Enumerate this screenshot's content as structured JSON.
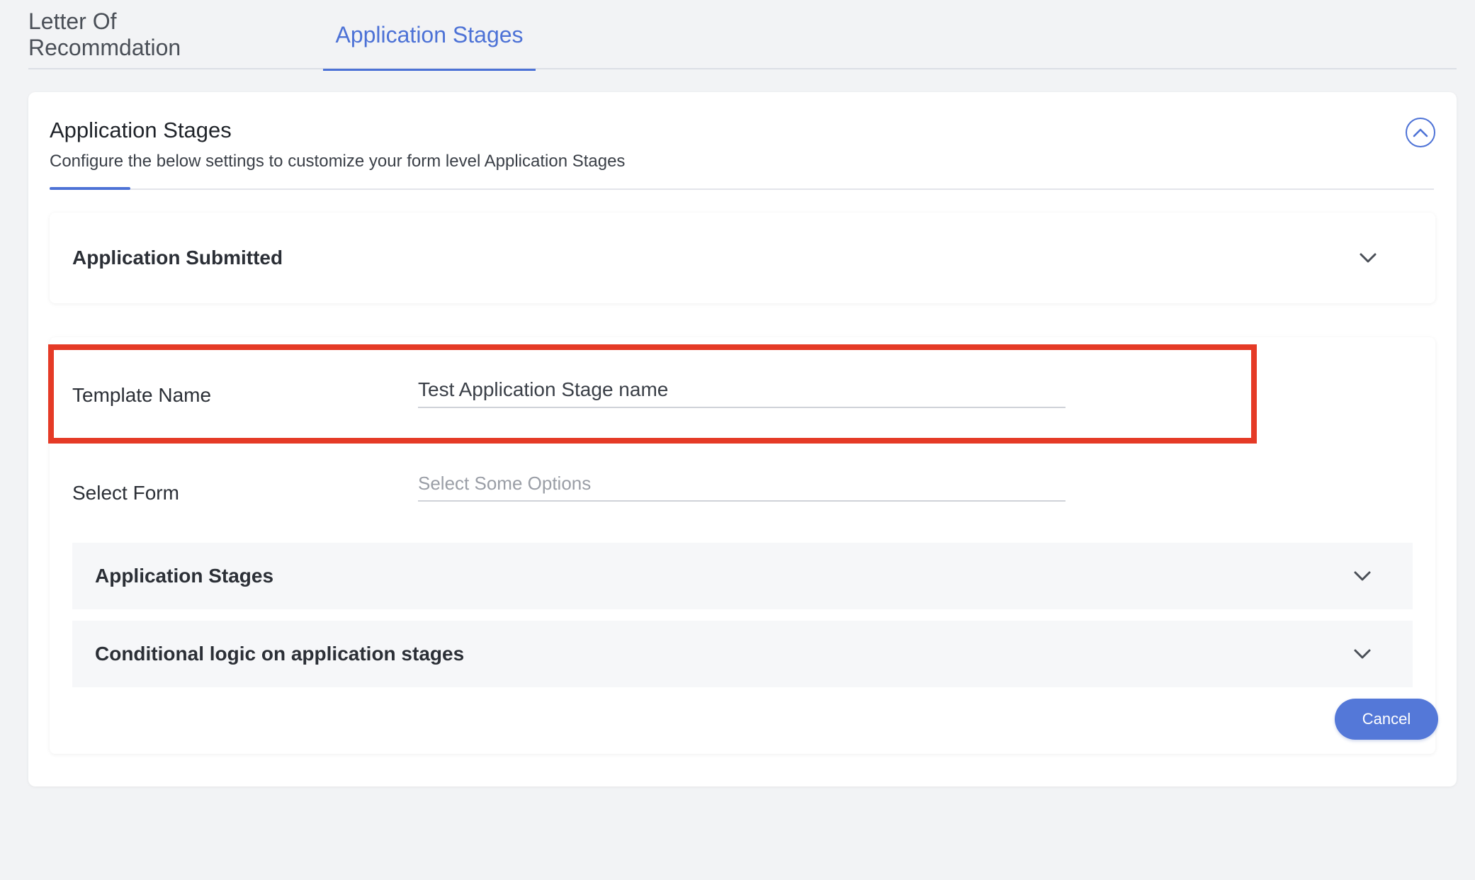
{
  "tabs": [
    {
      "label": "Letter Of Recommdation",
      "active": false
    },
    {
      "label": "Application Stages",
      "active": true
    }
  ],
  "card": {
    "title": "Application Stages",
    "subtitle": "Configure the below settings to customize your form level Application Stages",
    "collapse_icon": "chevron-up-circle-icon"
  },
  "accordions": {
    "application_submitted": {
      "label": "Application Submitted",
      "icon": "chevron-down-icon"
    }
  },
  "form": {
    "template_name": {
      "label": "Template Name",
      "value": "Test Application Stage name"
    },
    "select_form": {
      "label": "Select Form",
      "placeholder": "Select Some Options"
    },
    "sections": [
      {
        "label": "Application Stages",
        "icon": "chevron-down-icon"
      },
      {
        "label": "Conditional logic on application stages",
        "icon": "chevron-down-icon"
      }
    ],
    "cancel_label": "Cancel"
  },
  "colors": {
    "accent": "#4d72d6",
    "highlight": "#e53a26",
    "background": "#f2f3f5"
  }
}
